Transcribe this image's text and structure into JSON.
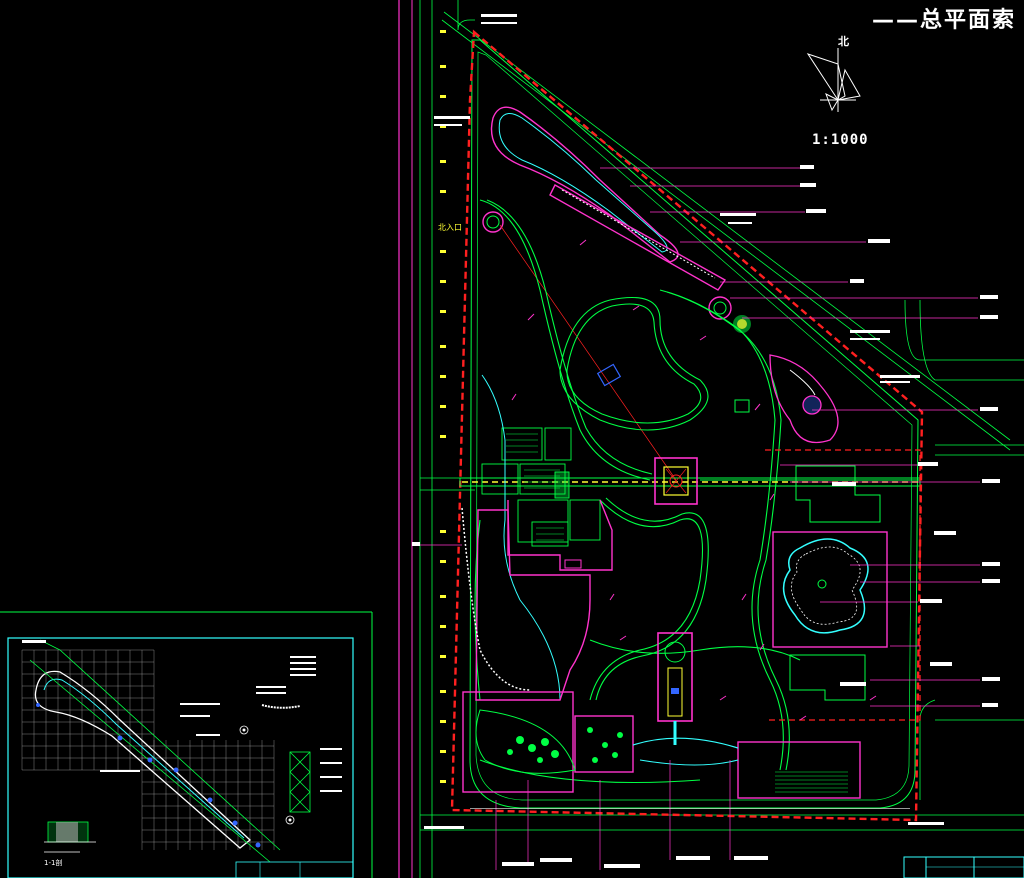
{
  "title": "——总平面索",
  "north_label": "北",
  "scale_label": "1:1000",
  "gate_label": "北入口",
  "section_label": "1-1剖",
  "colors": {
    "background": "#000000",
    "boundary": "#ff2020",
    "magenta": "#ff33cc",
    "green": "#00ff44",
    "cyan": "#33ffff",
    "yellow": "#ffff33",
    "white": "#ffffff"
  }
}
